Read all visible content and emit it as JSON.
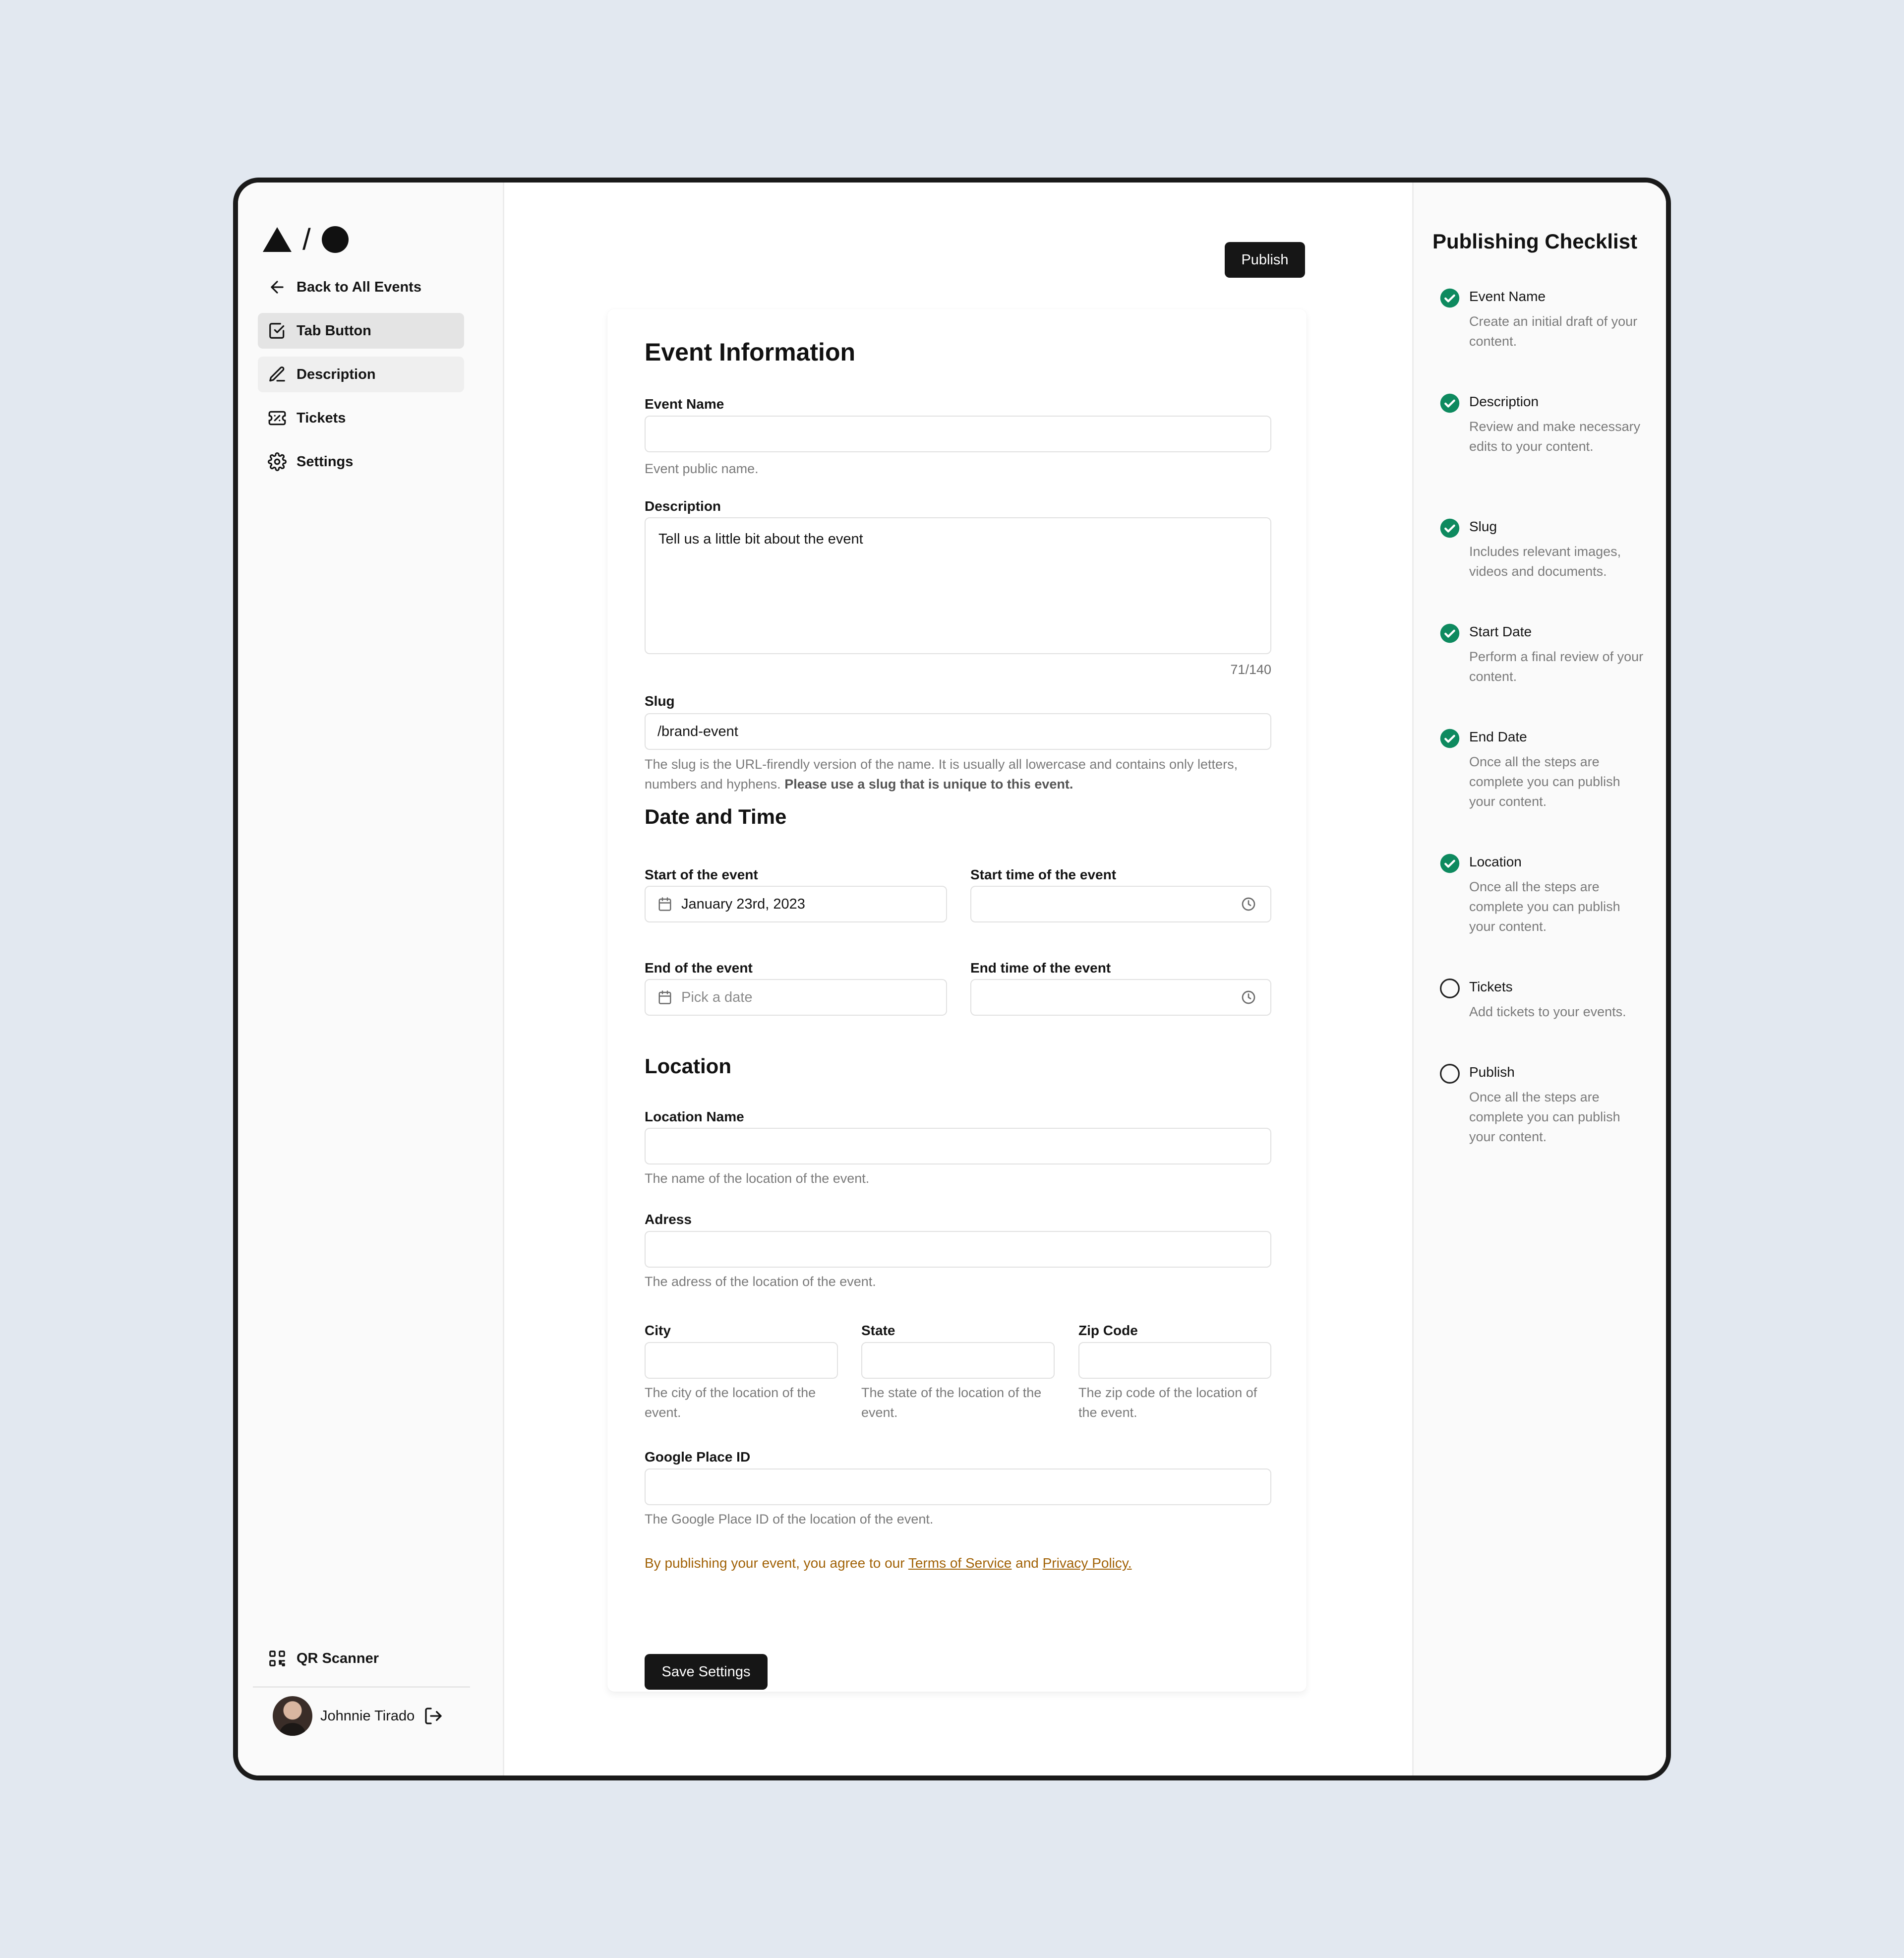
{
  "sidebar": {
    "back_label": "Back to All Events",
    "items": [
      {
        "label": "Tab Button",
        "icon": "checkbox-icon"
      },
      {
        "label": "Description",
        "icon": "pencil-icon"
      },
      {
        "label": "Tickets",
        "icon": "ticket-icon"
      },
      {
        "label": "Settings",
        "icon": "gear-icon"
      }
    ],
    "qr_label": "QR Scanner",
    "user_name": "Johnnie Tirado"
  },
  "header": {
    "publish_label": "Publish"
  },
  "form": {
    "title": "Event Information",
    "event_name": {
      "label": "Event Name",
      "value": "",
      "help": "Event public name."
    },
    "description": {
      "label": "Description",
      "value": "Tell us a little bit about the event",
      "counter": "71/140"
    },
    "slug": {
      "label": "Slug",
      "value": "/brand-event",
      "help": "The slug is the URL-firendly version of the name. It is usually all lowercase and contains only letters, numbers and hyphens.",
      "help_bold": "Please use a slug that is unique to this event."
    },
    "date_time": {
      "title": "Date and Time",
      "start_label": "Start of the event",
      "start_value": "January 23rd, 2023",
      "start_time_label": "Start time of the event",
      "end_label": "End of the event",
      "end_placeholder": "Pick a date",
      "end_time_label": "End time of the event"
    },
    "location": {
      "title": "Location",
      "name_label": "Location Name",
      "name_help": "The name of the location of the event.",
      "address_label": "Adress",
      "address_help": "The adress of the location of the event.",
      "city_label": "City",
      "city_help": "The city of the location of the event.",
      "state_label": "State",
      "state_help": "The state of the location of the event.",
      "zip_label": "Zip Code",
      "zip_help": "The zip code of the location of the event.",
      "place_label": "Google Place ID",
      "place_help": "The Google Place ID of the location of the event."
    },
    "terms": {
      "prefix": "By publishing your event, you agree to our",
      "tos": "Terms of Service",
      "and": "and",
      "privacy": "Privacy Policy."
    },
    "save_label": "Save Settings"
  },
  "checklist": {
    "title": "Publishing Checklist",
    "steps": [
      {
        "title": "Event Name",
        "desc": "Create an initial draft of your content.",
        "done": true
      },
      {
        "title": "Description",
        "desc": "Review and make necessary edits to your content.",
        "done": true
      },
      {
        "title": "Slug",
        "desc": "Includes relevant images, videos and documents.",
        "done": true
      },
      {
        "title": "Start Date",
        "desc": "Perform a final review of your content.",
        "done": true
      },
      {
        "title": "End Date",
        "desc": "Once all the steps are complete you can publish your content.",
        "done": true
      },
      {
        "title": "Location",
        "desc": "Once all the steps are complete you can publish your content.",
        "done": true
      },
      {
        "title": "Tickets",
        "desc": "Add tickets to your events.",
        "done": false
      },
      {
        "title": "Publish",
        "desc": "Once all the steps are complete you can publish your content.",
        "done": false
      }
    ]
  },
  "colors": {
    "accent_dark": "#161616",
    "check_green": "#0e8a5f",
    "terms_amber": "#a16207",
    "background": "#e2e8f0"
  }
}
